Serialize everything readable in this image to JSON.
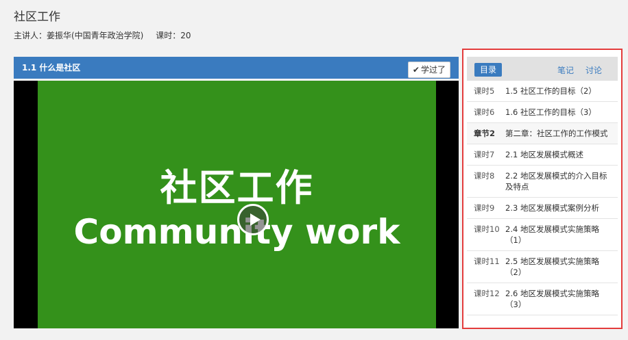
{
  "course": {
    "title": "社区工作",
    "lecturer": "主讲人：姜振华(中国青年政治学院)",
    "hours": "课时：20"
  },
  "player": {
    "lesson_title": "1.1 什么是社区",
    "learned_label": "学过了",
    "video_title_cn": "社区工作",
    "video_title_en": "Community work",
    "frame_color": "#34911b",
    "header_color": "#3a7bbf"
  },
  "sidebar": {
    "tabs": {
      "catalog": "目录",
      "notes": "笔记",
      "discuss": "讨论"
    },
    "rows": [
      {
        "idx": "课时5",
        "name": "1.5 社区工作的目标（2）"
      },
      {
        "idx": "课时6",
        "name": "1.6 社区工作的目标（3）"
      },
      {
        "idx": "章节2",
        "name": "第二章：社区工作的工作模式"
      },
      {
        "idx": "课时7",
        "name": "2.1 地区发展模式概述"
      },
      {
        "idx": "课时8",
        "name": "2.2 地区发展模式的介入目标及特点"
      },
      {
        "idx": "课时9",
        "name": "2.3 地区发展模式案例分析"
      },
      {
        "idx": "课时10",
        "name": "2.4 地区发展模式实施策略（1）"
      },
      {
        "idx": "课时11",
        "name": "2.5 地区发展模式实施策略（2）"
      },
      {
        "idx": "课时12",
        "name": "2.6 地区发展模式实施策略（3）"
      }
    ]
  }
}
